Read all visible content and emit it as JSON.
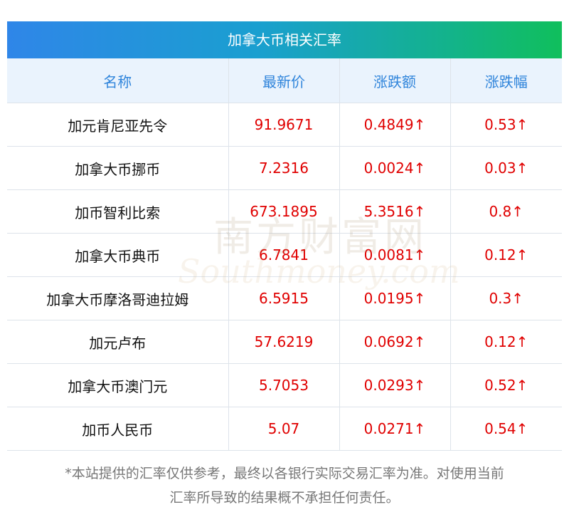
{
  "header": {
    "title": "加拿大币相关汇率"
  },
  "columns": [
    "名称",
    "最新价",
    "涨跌额",
    "涨跌幅"
  ],
  "rows": [
    {
      "name": "加元肯尼亚先令",
      "price": "91.9671",
      "change": "0.4849↑",
      "pct": "0.53↑"
    },
    {
      "name": "加拿大币挪币",
      "price": "7.2316",
      "change": "0.0024↑",
      "pct": "0.03↑"
    },
    {
      "name": "加币智利比索",
      "price": "673.1895",
      "change": "5.3516↑",
      "pct": "0.8↑"
    },
    {
      "name": "加拿大币典币",
      "price": "6.7841",
      "change": "0.0081↑",
      "pct": "0.12↑"
    },
    {
      "name": "加拿大币摩洛哥迪拉姆",
      "price": "6.5915",
      "change": "0.0195↑",
      "pct": "0.3↑"
    },
    {
      "name": "加元卢布",
      "price": "57.6219",
      "change": "0.0692↑",
      "pct": "0.12↑"
    },
    {
      "name": "加拿大币澳门元",
      "price": "5.7053",
      "change": "0.0293↑",
      "pct": "0.52↑"
    },
    {
      "name": "加币人民币",
      "price": "5.07",
      "change": "0.0271↑",
      "pct": "0.54↑"
    }
  ],
  "note": {
    "line1": "*本站提供的汇率仅供参考，最终以各银行实际交易汇率为准。对使用当前",
    "line2": "汇率所导致的结果概不承担任何责任。"
  },
  "watermark": {
    "cn": "南方财富网",
    "en": "Southmoney.com"
  },
  "colors": {
    "header_start": "#2f86e8",
    "header_end": "#10bf5c",
    "up": "#e00000",
    "column_header": "#2f84db"
  }
}
